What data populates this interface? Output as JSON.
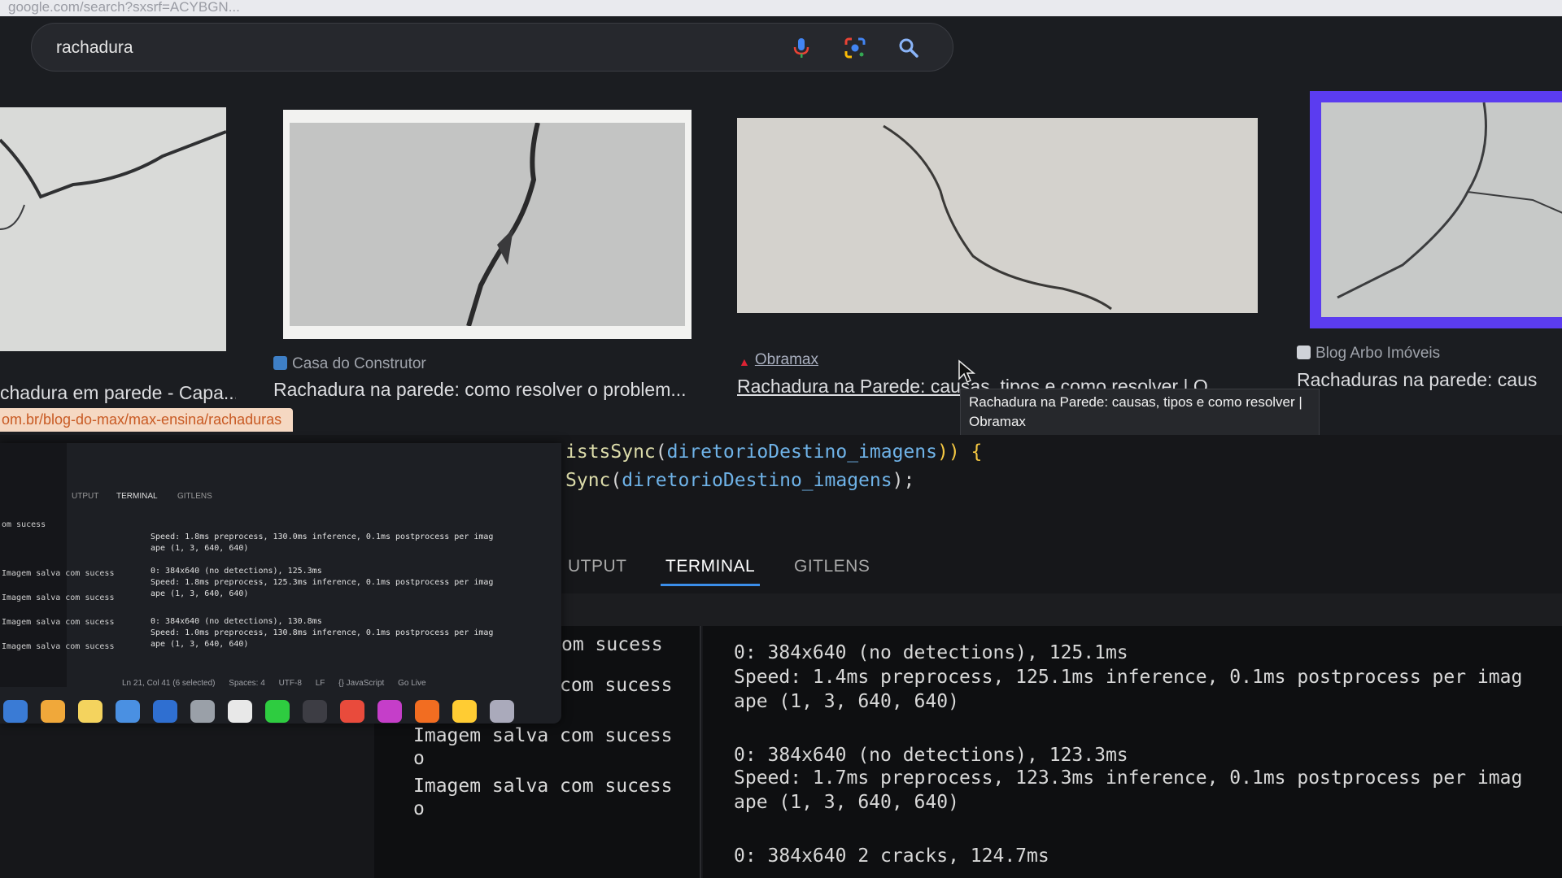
{
  "browser": {
    "url_partial": "google.com/search?sxsrf=ACYBGN...",
    "search": {
      "query": "rachadura"
    },
    "icons": [
      "mic-icon",
      "lens-icon",
      "search-icon"
    ],
    "results": [
      {
        "source": "",
        "title": "chadura em parede - Capa..."
      },
      {
        "source": "Casa do Construtor",
        "title": "Rachadura na parede: como resolver o problem..."
      },
      {
        "source": "Obramax",
        "title": "Rachadura na Parede: causas, tipos e como resolver | O"
      },
      {
        "source": "Blog Arbo Imóveis",
        "title": "Rachaduras na parede: caus"
      }
    ],
    "status_url": "om.br/blog-do-max/max-ensina/rachaduras",
    "tooltip": "Rachadura na Parede: causas, tipos e como resolver | Obramax",
    "selected_border_color": "#5b3cf0"
  },
  "editor": {
    "code": {
      "line1": {
        "fn": "istsSync",
        "arg": "diretorioDestino_imagens",
        "tail": ")) {"
      },
      "line2": {
        "fn": "Sync",
        "arg": "diretorioDestino_imagens",
        "tail": ");"
      }
    },
    "panel_tabs": {
      "output": "UTPUT",
      "terminal": "TERMINAL",
      "gitlens": "GITLENS"
    },
    "terminal_left": [
      "om sucess",
      "Imagem salva com sucess",
      "o",
      "Imagem salva com sucess",
      "o",
      "Imagem salva com sucess",
      "o"
    ],
    "terminal_right": [
      "0: 384x640 (no detections), 125.1ms",
      "Speed: 1.4ms preprocess, 125.1ms inference, 0.1ms postprocess per imag",
      "ape (1, 3, 640, 640)",
      "0: 384x640 (no detections), 123.3ms",
      "Speed: 1.7ms preprocess, 123.3ms inference, 0.1ms postprocess per imag",
      "ape (1, 3, 640, 640)",
      "0: 384x640 2 cracks, 124.7ms"
    ],
    "accent_color": "#3b8eea"
  },
  "laptop": {
    "tabs": [
      "UTPUT",
      "TERMINAL",
      "GITLENS"
    ],
    "left_lines": [
      "om sucess",
      "Imagem salva com sucess",
      "Imagem salva com sucess",
      "Imagem salva com sucess",
      "Imagem salva com sucess"
    ],
    "terminal_lines": [
      "Speed: 1.8ms preprocess, 130.0ms inference, 0.1ms postprocess per imag",
      "ape (1, 3, 640, 640)",
      "0: 384x640 (no detections), 125.3ms",
      "Speed: 1.8ms preprocess, 125.3ms inference, 0.1ms postprocess per imag",
      "ape (1, 3, 640, 640)",
      "0: 384x640 (no detections), 130.8ms",
      "Speed: 1.0ms preprocess, 130.8ms inference, 0.1ms postprocess per imag",
      "ape (1, 3, 640, 640)"
    ],
    "status": {
      "position": "Ln 21, Col 41 (6 selected)",
      "spaces": "Spaces: 4",
      "encoding": "UTF-8",
      "eol": "LF",
      "language": "{} JavaScript",
      "golive": "Go Live"
    },
    "dock_colors": [
      "#3a7bd5",
      "#f0a83a",
      "#f4d35e",
      "#4a90e2",
      "#2f6fd1",
      "#9aa0a8",
      "#e8e8e8",
      "#2ecc40",
      "#3d3d44",
      "#e94b3c",
      "#c53ec9",
      "#f26d21",
      "#ffcc33",
      "#aab"
    ]
  }
}
